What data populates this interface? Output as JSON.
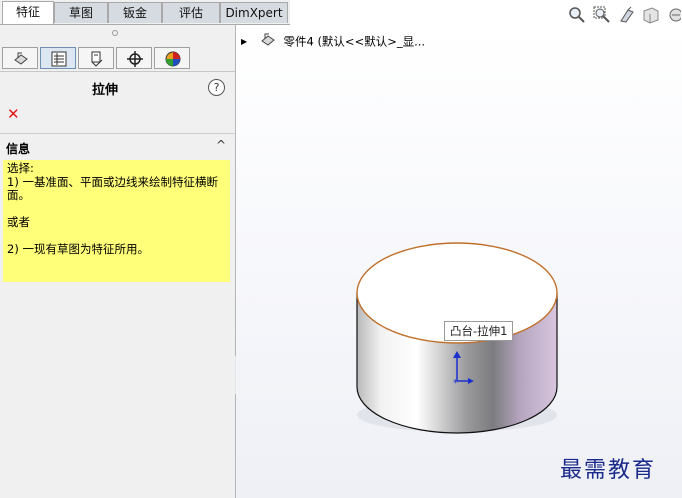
{
  "tabs": [
    {
      "label": "特征",
      "active": true
    },
    {
      "label": "草图",
      "active": false
    },
    {
      "label": "钣金",
      "active": false
    },
    {
      "label": "评估",
      "active": false
    },
    {
      "label": "DimXpert",
      "active": false
    }
  ],
  "panel_icons": [
    "featuremanager-tree-icon",
    "propertymanager-icon",
    "configurationmanager-icon",
    "dimxpertmanager-icon",
    "displaymanager-icon"
  ],
  "property_manager": {
    "title": "拉伸",
    "help_symbol": "?",
    "cancel_symbol": "✕"
  },
  "info": {
    "header": "信息",
    "chevron": "^",
    "lines": [
      "选择:",
      "1) 一基准面、平面或边线来绘制特征横断面。",
      "",
      "或者",
      "",
      "2) 一现有草图为特征所用。"
    ]
  },
  "tree": {
    "root_label": "零件4  (默认<<默认>_显..."
  },
  "viewport": {
    "tooltip": "凸台-拉伸1",
    "watermark": "最需教育"
  },
  "hud_icons": [
    "zoom-to-fit-icon",
    "zoom-to-area-icon",
    "previous-view-icon",
    "section-view-icon",
    "view-orientation-icon"
  ],
  "colors": {
    "accent": "#2060c0",
    "info_bg": "#ffff7a",
    "cancel": "#e01818",
    "edge": "#c0702a"
  }
}
